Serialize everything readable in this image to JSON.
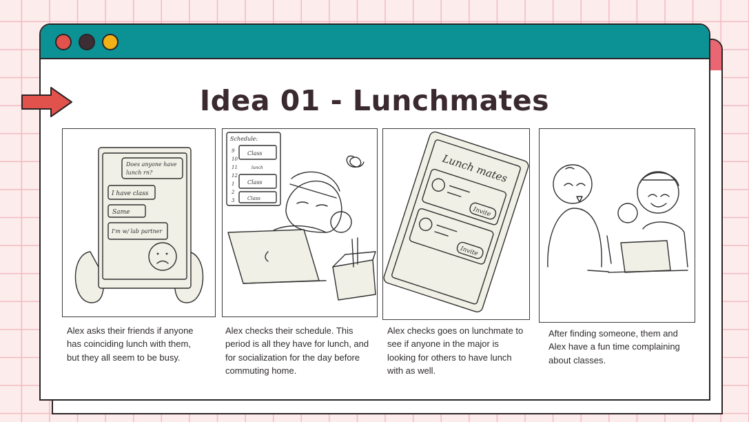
{
  "slide": {
    "title": "Idea 01 - Lunchmates",
    "colors": {
      "background": "#fcecec",
      "grid": "#f3b9bf",
      "titlebar": "#0c9295",
      "accent_red": "#e2524c",
      "accent_yellow": "#f2b116",
      "shadow_bar": "#ea6672",
      "text": "#3a2a2f"
    }
  },
  "window_controls": [
    "close-dot",
    "minimize-dot",
    "maximize-dot"
  ],
  "panels": [
    {
      "caption": "Alex asks their friends if anyone has coinciding lunch with them, but they all seem to be busy.",
      "sketch": {
        "bubble_1": "Does anyone have",
        "bubble_1b": "lunch rn?",
        "bubble_2": "I have class",
        "bubble_3": "Same",
        "bubble_4": "I'm w/ lab partner"
      }
    },
    {
      "caption": "Alex checks their schedule. This period is all they have for lunch, and for socialization for the day before commuting home.",
      "sketch": {
        "schedule_title": "Schedule:",
        "slots": [
          "Class",
          "lunch",
          "Class",
          "Class"
        ],
        "hours": [
          "9",
          "10",
          "11",
          "12",
          "1",
          "2",
          "3"
        ]
      }
    },
    {
      "caption": "Alex checks goes on lunchmate to see if anyone in the major is looking for others to have lunch with as well.",
      "sketch": {
        "app_name": "Lunch mates",
        "invite_1": "Invite",
        "invite_2": "Invite"
      }
    },
    {
      "caption": "After finding someone, them and Alex have a fun time complaining about classes.",
      "sketch": {}
    }
  ]
}
